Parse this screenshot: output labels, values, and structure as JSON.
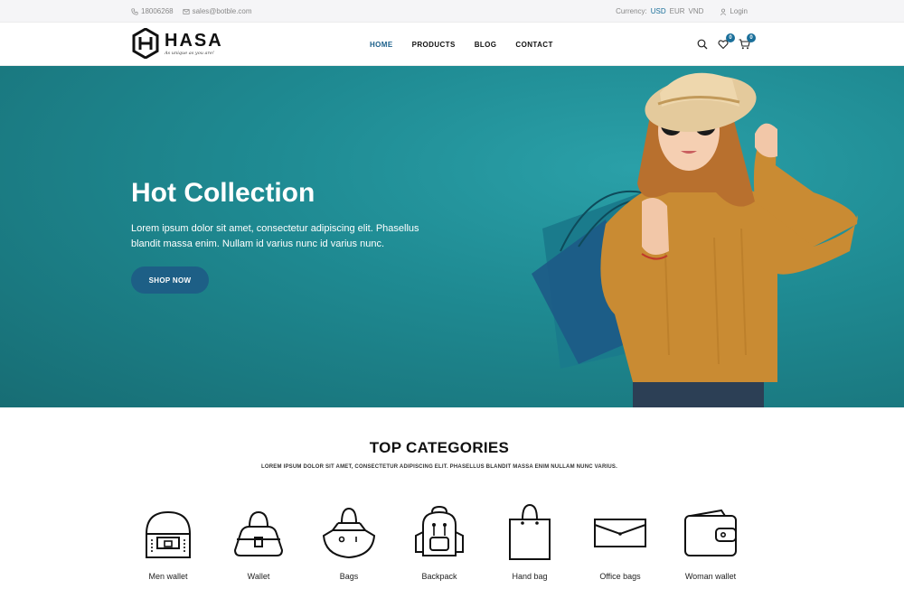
{
  "topbar": {
    "phone": "18006268",
    "email": "sales@botble.com",
    "currency_label": "Currency:",
    "currencies": [
      "USD",
      "EUR",
      "VND"
    ],
    "active_currency": "USD",
    "login": "Login"
  },
  "header": {
    "logo_name": "HASA",
    "logo_tagline": "As unique as you are!",
    "nav": [
      "HOME",
      "PRODUCTS",
      "BLOG",
      "CONTACT"
    ],
    "active_nav": "HOME",
    "wishlist_count": "0",
    "cart_count": "0"
  },
  "hero": {
    "title": "Hot Collection",
    "description": "Lorem ipsum dolor sit amet, consectetur adipiscing elit. Phasellus blandit massa enim. Nullam id varius nunc id varius nunc.",
    "button": "SHOP NOW"
  },
  "categories": {
    "title": "TOP CATEGORIES",
    "subtitle": "LOREM IPSUM DOLOR SIT AMET, CONSECTETUR ADIPISCING ELIT. PHASELLUS BLANDIT MASSA ENIM NULLAM NUNC VARIUS.",
    "items": [
      {
        "label": "Men wallet",
        "icon": "men-wallet-icon"
      },
      {
        "label": "Wallet",
        "icon": "wallet-icon"
      },
      {
        "label": "Bags",
        "icon": "bags-icon"
      },
      {
        "label": "Backpack",
        "icon": "backpack-icon"
      },
      {
        "label": "Hand bag",
        "icon": "hand-bag-icon"
      },
      {
        "label": "Office bags",
        "icon": "office-bags-icon"
      },
      {
        "label": "Woman wallet",
        "icon": "woman-wallet-icon"
      }
    ]
  },
  "colors": {
    "accent": "#1a6f9a",
    "hero_bg": "#1f8b93",
    "button_bg": "#1d5f86"
  }
}
